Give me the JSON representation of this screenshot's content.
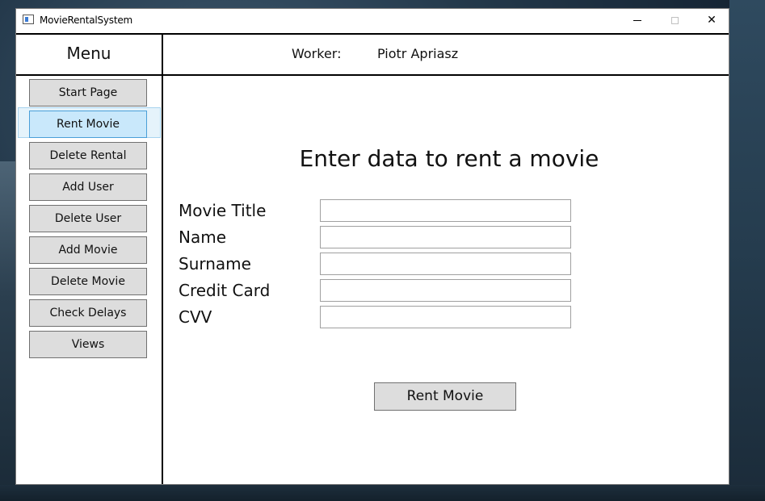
{
  "window": {
    "title": "MovieRentalSystem"
  },
  "header": {
    "menu_title": "Menu",
    "worker_label": "Worker:",
    "worker_name": "Piotr Apriasz"
  },
  "sidebar": {
    "items": [
      {
        "label": "Start Page",
        "active": false
      },
      {
        "label": "Rent Movie",
        "active": true
      },
      {
        "label": "Delete Rental",
        "active": false
      },
      {
        "label": "Add User",
        "active": false
      },
      {
        "label": "Delete User",
        "active": false
      },
      {
        "label": "Add Movie",
        "active": false
      },
      {
        "label": "Delete Movie",
        "active": false
      },
      {
        "label": "Check Delays",
        "active": false
      },
      {
        "label": "Views",
        "active": false
      }
    ]
  },
  "form": {
    "heading": "Enter data to rent a movie",
    "fields": [
      {
        "label": "Movie Title",
        "value": ""
      },
      {
        "label": "Name",
        "value": ""
      },
      {
        "label": "Surname",
        "value": ""
      },
      {
        "label": "Credit Card",
        "value": ""
      },
      {
        "label": "CVV",
        "value": ""
      }
    ],
    "submit_label": "Rent Movie"
  },
  "colors": {
    "button_bg": "#dddddd",
    "active_bg": "#c9e8fb",
    "active_border": "#4a9fd8"
  }
}
